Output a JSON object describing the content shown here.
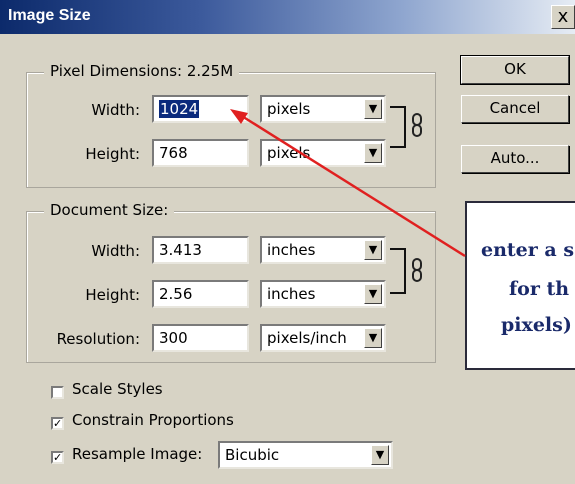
{
  "window": {
    "title": "Image Size",
    "close_glyph": "x"
  },
  "pixel_dimensions": {
    "legend": "Pixel Dimensions:  2.25M",
    "width_label": "Width:",
    "width_value": "1024",
    "width_unit": "pixels",
    "height_label": "Height:",
    "height_value": "768",
    "height_unit": "pixels"
  },
  "document_size": {
    "legend": "Document Size:",
    "width_label": "Width:",
    "width_value": "3.413",
    "width_unit": "inches",
    "height_label": "Height:",
    "height_value": "2.56",
    "height_unit": "inches",
    "resolution_label": "Resolution:",
    "resolution_value": "300",
    "resolution_unit": "pixels/inch"
  },
  "buttons": {
    "ok": "OK",
    "cancel": "Cancel",
    "auto": "Auto..."
  },
  "options": {
    "scale_styles": {
      "label": "Scale Styles",
      "checked": false
    },
    "constrain_proportions": {
      "label": "Constrain Proportions",
      "checked": true
    },
    "resample_image": {
      "label": "Resample Image:",
      "checked": true,
      "method": "Bicubic"
    }
  },
  "annotation": {
    "lines": [
      "enter a s",
      "for th",
      "pixels)"
    ],
    "arrow_color": "#e02020"
  },
  "icons": {
    "dropdown": "chevron-down-icon",
    "link": "chain-link-icon",
    "check": "checkmark-icon"
  }
}
